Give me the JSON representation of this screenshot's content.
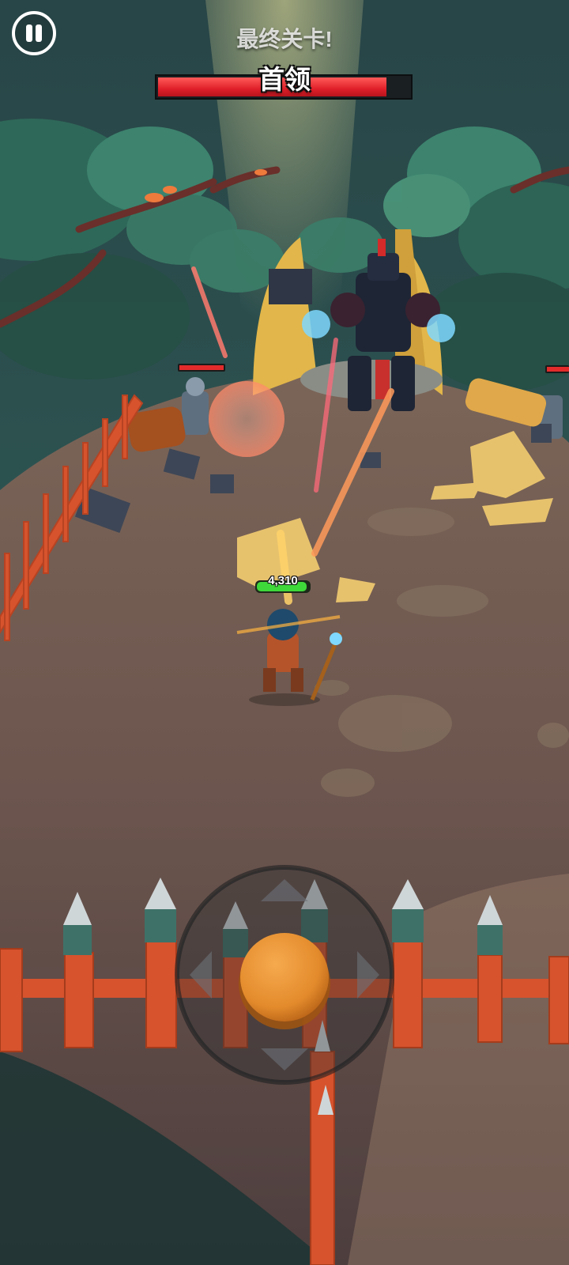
{
  "hud": {
    "stage_title": "最终关卡!",
    "boss_name": "首领",
    "boss_health_fraction": 0.91,
    "player_health_value": "4,310",
    "player_health_fraction": 0.9
  },
  "icons": {
    "pause": "pause-icon",
    "joystick": "virtual-joystick",
    "dpad_arrows": "chevron-arrows-icon"
  },
  "colors": {
    "boss_health": "#e0202a",
    "player_health": "#3fd83a",
    "enemy_health": "#e32b2b",
    "joystick_knob": "#e38b2c",
    "ground": "#6a544d",
    "fence": "#d6532d"
  }
}
